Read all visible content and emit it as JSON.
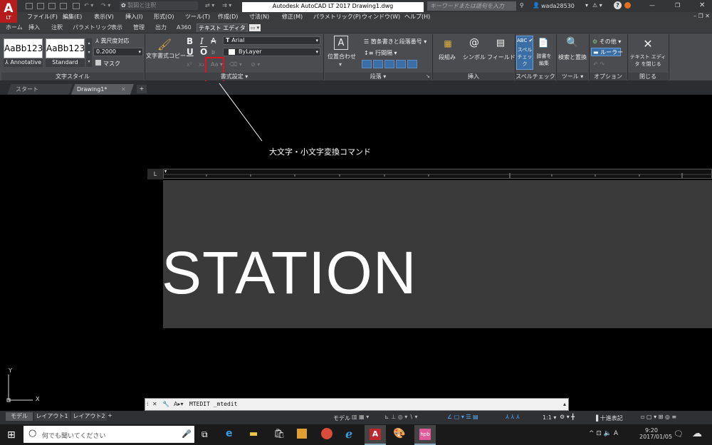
{
  "app": {
    "logo_text": "A",
    "logo_sub": "LT",
    "workspace_placeholder": "製図と注釈",
    "title": "Autodesk AutoCAD LT 2017   Drawing1.dwg",
    "search_placeholder": "キーワードまたは語句を入力",
    "username": "wada28530"
  },
  "menu": [
    "ファイル(F)",
    "編集(E)",
    "表示(V)",
    "挿入(I)",
    "形式(O)",
    "ツール(T)",
    "作成(D)",
    "寸法(N)",
    "修正(M)",
    "パラメトリック(P)",
    "ウィンドウ(W)",
    "ヘルプ(H)"
  ],
  "ribbon_tabs": [
    "ホーム",
    "挿入",
    "注釈",
    "パラメトリック",
    "表示",
    "管理",
    "出力",
    "A360",
    "テキスト エディタ"
  ],
  "styles": {
    "sample1": "AaBb123",
    "sample2": "AaBb123",
    "name1": "Annotative",
    "name2": "Standard",
    "annotative_scale": "異尺度対応",
    "height_value": "0.2000",
    "mask": "マスク",
    "panel": "文字スタイル"
  },
  "format": {
    "match": "文字書式コピー",
    "bold": "B",
    "italic": "I",
    "strike": "A",
    "underline": "U",
    "overline": "O",
    "font": "Arial",
    "color": "ByLayer",
    "case_btn": "Aa",
    "panel": "書式設定 ▾"
  },
  "paragraph": {
    "justify": "位置合わせ",
    "bullets": "箇条書きと段落番号 ▾",
    "linespace": "行間隔 ▾",
    "panel": "段落 ▾"
  },
  "insert": {
    "columns": "段組み",
    "symbol": "シンボル",
    "field": "フィールド",
    "panel": "挿入"
  },
  "spell": {
    "check": "スペル チェック",
    "dict": "辞書を 編集",
    "panel": "スペルチェック"
  },
  "tools": {
    "find": "検索と置換",
    "panel": "ツール ▾"
  },
  "options": {
    "more": "その他 ▾",
    "ruler": "ルーラー",
    "panel": "オプション"
  },
  "close": {
    "label": "テキスト エディタ を閉じる",
    "panel": "閉じる"
  },
  "doctabs": [
    "スタート",
    "Drawing1*"
  ],
  "annotation": "大文字・小文字変換コマンド",
  "canvas_text": "STATION",
  "ucs": {
    "x": "X",
    "y": "Y"
  },
  "command": "MTEDIT _mtedit",
  "layout_tabs": [
    "モデル",
    "レイアウト1",
    "レイアウト2"
  ],
  "status": {
    "model": "モデル",
    "scale": "1:1",
    "units": "十進表記"
  },
  "taskbar": {
    "search_placeholder": "何でも聞いてください",
    "time": "9:20",
    "date": "2017/01/05",
    "ime": "A"
  }
}
